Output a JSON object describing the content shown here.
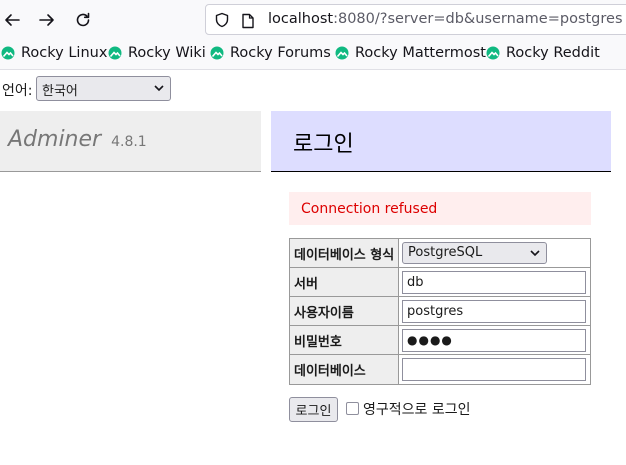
{
  "browser": {
    "url_host": "localhost",
    "url_rest": ":8080/?server=db&username=postgres"
  },
  "bookmarks": [
    {
      "label": "Rocky Linux"
    },
    {
      "label": "Rocky Wiki"
    },
    {
      "label": "Rocky Forums"
    },
    {
      "label": "Rocky Mattermost"
    },
    {
      "label": "Rocky Reddit"
    }
  ],
  "language": {
    "label": "언어:",
    "selected": "한국어"
  },
  "adminer": {
    "name": "Adminer",
    "version": "4.8.1"
  },
  "login": {
    "heading": "로그인",
    "error": "Connection refused",
    "fields": {
      "system_label": "데이터베이스 형식",
      "system_value": "PostgreSQL",
      "server_label": "서버",
      "server_value": "db",
      "username_label": "사용자이름",
      "username_value": "postgres",
      "password_label": "비밀번호",
      "password_value": "●●●●",
      "database_label": "데이터베이스",
      "database_value": ""
    },
    "submit_label": "로그인",
    "permanent_label": "영구적으로 로그인"
  },
  "colors": {
    "login_header_bg": "#ddddff",
    "error_bg": "#ffeeee",
    "error_text": "#dd0000",
    "bookmark_icon": "#10b981"
  }
}
